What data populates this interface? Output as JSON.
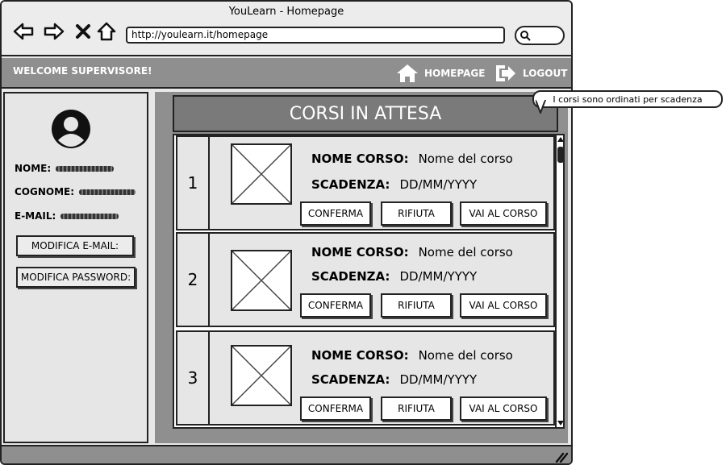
{
  "window": {
    "title": "YouLearn - Homepage",
    "url": "http://youlearn.it/homepage"
  },
  "icons": {
    "back": "arrow-left-icon",
    "forward": "arrow-right-icon",
    "close": "x-icon",
    "home": "home-icon",
    "search": "search-icon",
    "logout": "logout-icon",
    "avatar": "user-avatar-icon",
    "placeholder": "image-placeholder-icon"
  },
  "topbar": {
    "welcome": "WELCOME SUPERVISORE!",
    "homepage": "HOMEPAGE",
    "logout": "LOGOUT"
  },
  "sidebar": {
    "nome_label": "NOME:",
    "cognome_label": "COGNOME:",
    "email_label": "E-MAIL:",
    "modifica_email": "MODIFICA E-MAIL:",
    "modifica_password": "MODIFICA PASSWORD:"
  },
  "panel": {
    "title": "CORSI IN ATTESA"
  },
  "courses": [
    {
      "num": "1",
      "nome_label": "NOME CORSO:",
      "nome": "Nome del corso",
      "scadenza_label": "SCADENZA:",
      "scadenza": "DD/MM/YYYY",
      "conferma": "CONFERMA",
      "rifiuta": "RIFIUTA",
      "vai": "VAI AL CORSO"
    },
    {
      "num": "2",
      "nome_label": "NOME CORSO:",
      "nome": "Nome del corso",
      "scadenza_label": "SCADENZA:",
      "scadenza": "DD/MM/YYYY",
      "conferma": "CONFERMA",
      "rifiuta": "RIFIUTA",
      "vai": "VAI AL CORSO"
    },
    {
      "num": "3",
      "nome_label": "NOME CORSO:",
      "nome": "Nome del corso",
      "scadenza_label": "SCADENZA:",
      "scadenza": "DD/MM/YYYY",
      "conferma": "CONFERMA",
      "rifiuta": "RIFIUTA",
      "vai": "VAI AL CORSO"
    }
  ],
  "tooltip": {
    "text": "I corsi sono ordinati per scadenza"
  },
  "colors": {
    "dark_gray": "#8f8f8f",
    "header_gray": "#7a7a7a",
    "light_gray": "#e6e6e6"
  }
}
